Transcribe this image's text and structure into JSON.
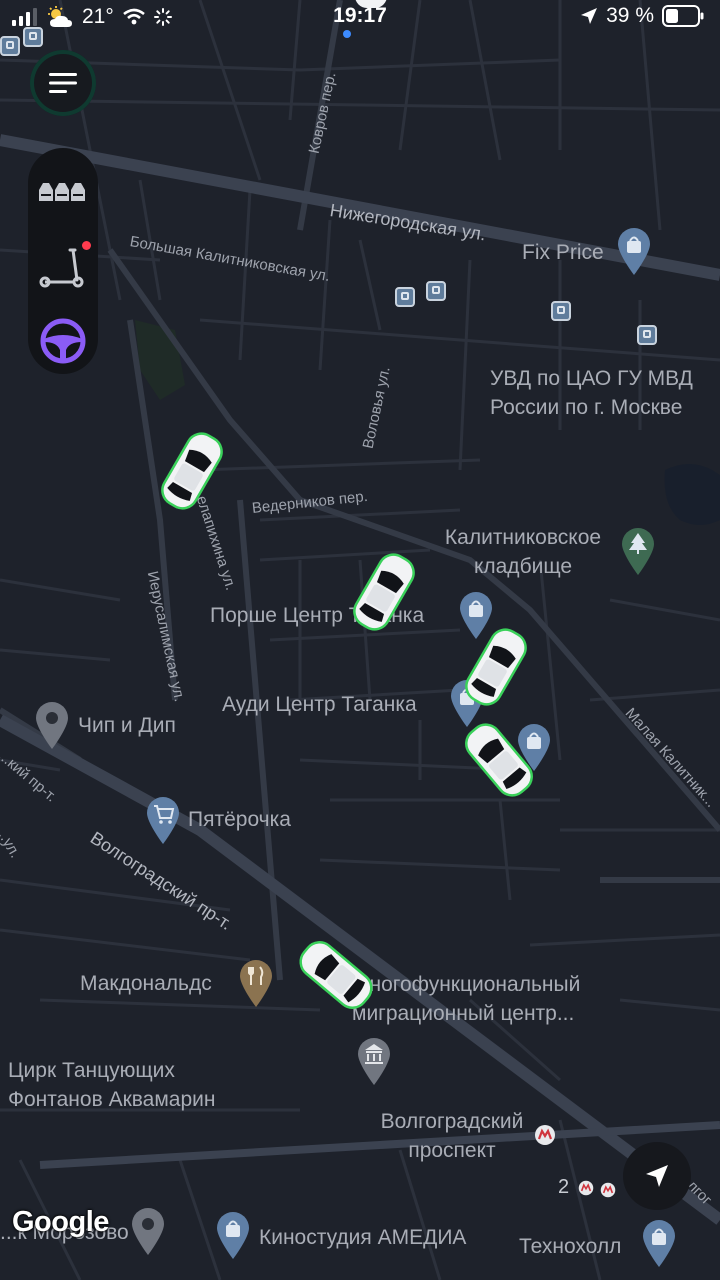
{
  "status_bar": {
    "temperature": "21°",
    "time": "19:17",
    "battery": "39 %"
  },
  "streets": {
    "kovrov": "Ковров пер.",
    "nizhegorodskaya": "Нижегородская ул.",
    "bolshaya_kalitnikovskaya": "Большая Калитниковская ул.",
    "volovya": "Воловья ул.",
    "vedernikov": "Ведерников пер.",
    "shelapikhina": "...елапихина ул.",
    "ierusalimskaya": "Иерусалимская ул.",
    "malaya_kalitnikovskaya": "Малая Калитник...",
    "volgogradsky": "Волгоградский пр-т.",
    "left_prt": "...кий пр-т.",
    "left_ul": "...ул.",
    "right_edge": "...олгог"
  },
  "pois": {
    "fix_price": "Fix Price",
    "uvd_line1": "УВД по ЦАО ГУ МВД",
    "uvd_line2": "России по г. Москве",
    "cemetery_line1": "Калитниковское",
    "cemetery_line2": "кладбище",
    "porsche": "Порше Центр Таганка",
    "audi": "Ауди Центр Таганка",
    "chip_dip": "Чип и Дип",
    "pyaterochka": "Пятёрочка",
    "mcdonalds": "Макдональдс",
    "migration_line1": "Многофункциональный",
    "migration_line2": "миграционный центр...",
    "circus_line1": "Цирк Танцующих",
    "circus_line2": "Фонтанов Аквамарин",
    "metro_line1": "Волгоградский",
    "metro_line2": "проспект",
    "kinostudio": "Киностудия АМЕДИА",
    "tekhnokholl": "Технохолл",
    "morozovo": "...к Морозово",
    "metro_number": "2"
  },
  "icons": {
    "menu": "hamburger-menu-icon",
    "taxi": "taxi-cars-icon",
    "scooter": "kick-scooter-icon",
    "drive": "steering-wheel-icon",
    "locate": "navigation-arrow-icon"
  },
  "colors": {
    "map_bg": "#1e222b",
    "drive_accent": "#8b5cf6",
    "car_outline": "#3ad15a",
    "notification_dot": "#ff3b4e"
  },
  "attribution": "Google"
}
